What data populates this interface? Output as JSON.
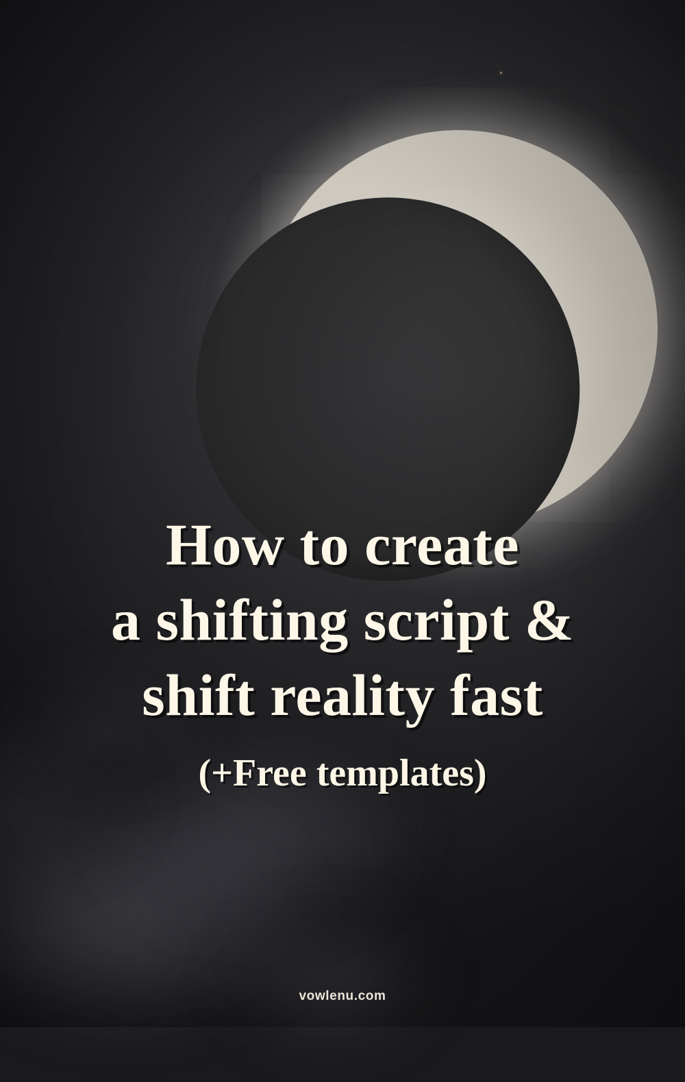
{
  "title_lines": {
    "l1": "How to create",
    "l2": "a shifting script &",
    "l3": "shift reality fast"
  },
  "subtitle": "(+Free templates)",
  "footer": "vowlenu.com"
}
